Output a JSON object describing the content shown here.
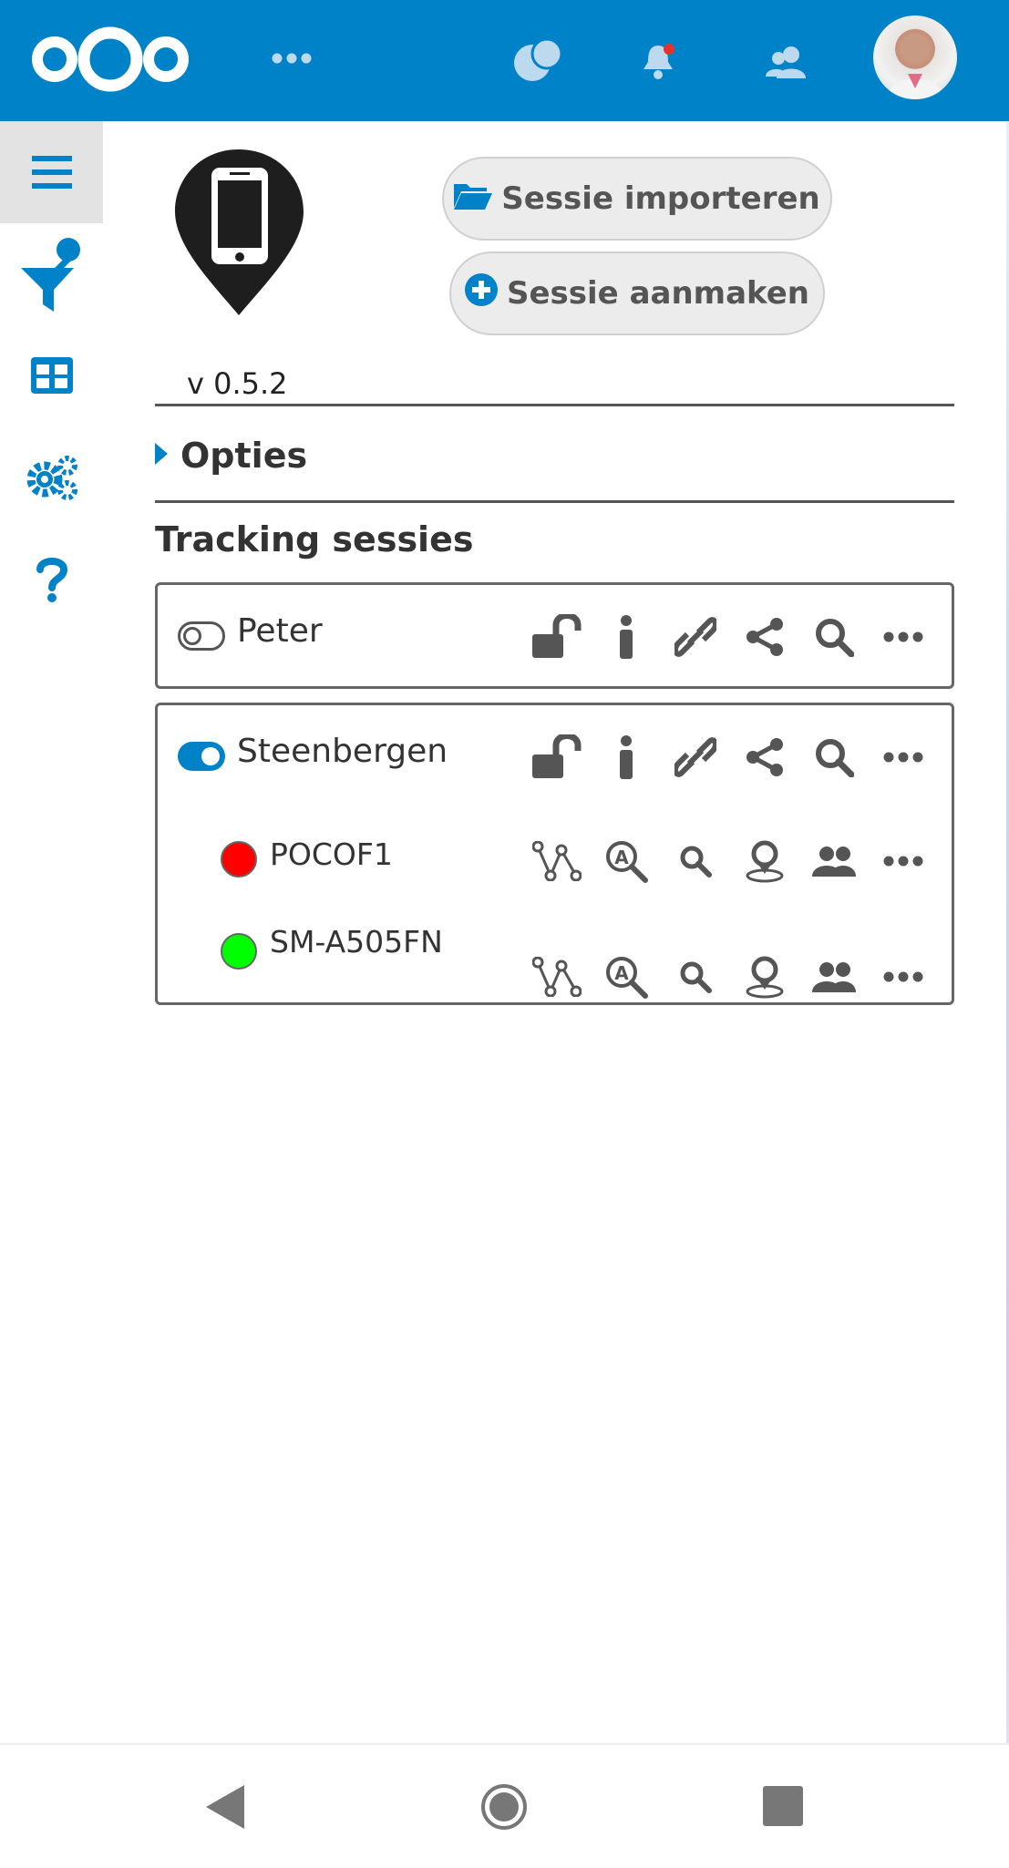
{
  "header": {
    "logo_icon": "nextcloud-logo",
    "apps_menu_icon": "more-apps-icon",
    "talk_icon": "talk-icon",
    "notifications_icon": "bell-icon",
    "contacts_icon": "contacts-icon",
    "avatar_icon": "user-avatar",
    "brand_color": "#0082c9"
  },
  "sidebar": {
    "items": [
      {
        "name": "menu",
        "icon": "hamburger-icon"
      },
      {
        "name": "filter",
        "icon": "filter-icon"
      },
      {
        "name": "table",
        "icon": "table-icon"
      },
      {
        "name": "settings",
        "icon": "gears-icon"
      },
      {
        "name": "help",
        "icon": "help-icon"
      }
    ]
  },
  "app": {
    "version": "v 0.5.2",
    "import_button": "Sessie importeren",
    "create_button": "Sessie aanmaken",
    "options_label": "Opties",
    "sessions_title": "Tracking sessies"
  },
  "sessions": [
    {
      "name": "Peter",
      "enabled": false,
      "devices": []
    },
    {
      "name": "Steenbergen",
      "enabled": true,
      "devices": [
        {
          "name": "POCOF1",
          "color": "#ff0000"
        },
        {
          "name": "SM-A505FN",
          "color": "#00ff00"
        }
      ]
    }
  ],
  "colors": {
    "accent": "#0082c9",
    "icon_gray": "#555555"
  }
}
